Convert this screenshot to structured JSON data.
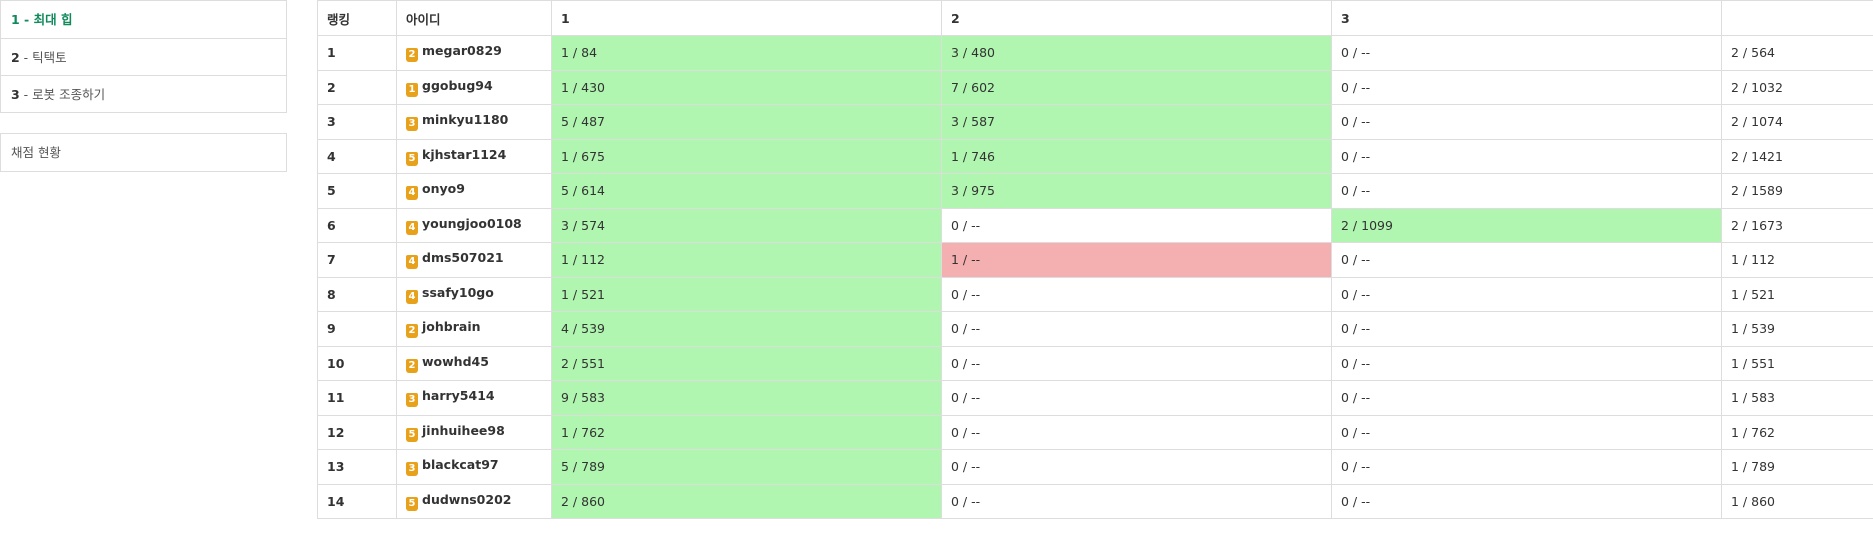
{
  "sidebar": {
    "problems": [
      {
        "num": "1",
        "title": " - 최대 힙",
        "active": true
      },
      {
        "num": "2",
        "title": " - 틱택토",
        "active": false
      },
      {
        "num": "3",
        "title": " - 로봇 조종하기",
        "active": false
      }
    ],
    "status_link": "채점 현황"
  },
  "table": {
    "headers": [
      "랭킹",
      "아이디",
      "1",
      "2",
      "3",
      ""
    ],
    "rows": [
      {
        "rank": "1",
        "tier": "2",
        "user": "megar0829",
        "p1": "1 / 84",
        "p1s": "ac",
        "p2": "3 / 480",
        "p2s": "ac",
        "p3": "0 / --",
        "p3s": "",
        "total": "2 / 564"
      },
      {
        "rank": "2",
        "tier": "1",
        "user": "ggobug94",
        "p1": "1 / 430",
        "p1s": "ac",
        "p2": "7 / 602",
        "p2s": "ac",
        "p3": "0 / --",
        "p3s": "",
        "total": "2 / 1032"
      },
      {
        "rank": "3",
        "tier": "3",
        "user": "minkyu1180",
        "p1": "5 / 487",
        "p1s": "ac",
        "p2": "3 / 587",
        "p2s": "ac",
        "p3": "0 / --",
        "p3s": "",
        "total": "2 / 1074"
      },
      {
        "rank": "4",
        "tier": "5",
        "user": "kjhstar1124",
        "p1": "1 / 675",
        "p1s": "ac",
        "p2": "1 / 746",
        "p2s": "ac",
        "p3": "0 / --",
        "p3s": "",
        "total": "2 / 1421"
      },
      {
        "rank": "5",
        "tier": "4",
        "user": "onyo9",
        "p1": "5 / 614",
        "p1s": "ac",
        "p2": "3 / 975",
        "p2s": "ac",
        "p3": "0 / --",
        "p3s": "",
        "total": "2 / 1589"
      },
      {
        "rank": "6",
        "tier": "4",
        "user": "youngjoo0108",
        "p1": "3 / 574",
        "p1s": "ac",
        "p2": "0 / --",
        "p2s": "",
        "p3": "2 / 1099",
        "p3s": "ac",
        "total": "2 / 1673"
      },
      {
        "rank": "7",
        "tier": "4",
        "user": "dms507021",
        "p1": "1 / 112",
        "p1s": "ac",
        "p2": "1 / --",
        "p2s": "wa",
        "p3": "0 / --",
        "p3s": "",
        "total": "1 / 112"
      },
      {
        "rank": "8",
        "tier": "4",
        "user": "ssafy10go",
        "p1": "1 / 521",
        "p1s": "ac",
        "p2": "0 / --",
        "p2s": "",
        "p3": "0 / --",
        "p3s": "",
        "total": "1 / 521"
      },
      {
        "rank": "9",
        "tier": "2",
        "user": "johbrain",
        "p1": "4 / 539",
        "p1s": "ac",
        "p2": "0 / --",
        "p2s": "",
        "p3": "0 / --",
        "p3s": "",
        "total": "1 / 539"
      },
      {
        "rank": "10",
        "tier": "2",
        "user": "wowhd45",
        "p1": "2 / 551",
        "p1s": "ac",
        "p2": "0 / --",
        "p2s": "",
        "p3": "0 / --",
        "p3s": "",
        "total": "1 / 551"
      },
      {
        "rank": "11",
        "tier": "3",
        "user": "harry5414",
        "p1": "9 / 583",
        "p1s": "ac",
        "p2": "0 / --",
        "p2s": "",
        "p3": "0 / --",
        "p3s": "",
        "total": "1 / 583"
      },
      {
        "rank": "12",
        "tier": "5",
        "user": "jinhuihee98",
        "p1": "1 / 762",
        "p1s": "ac",
        "p2": "0 / --",
        "p2s": "",
        "p3": "0 / --",
        "p3s": "",
        "total": "1 / 762"
      },
      {
        "rank": "13",
        "tier": "3",
        "user": "blackcat97",
        "p1": "5 / 789",
        "p1s": "ac",
        "p2": "0 / --",
        "p2s": "",
        "p3": "0 / --",
        "p3s": "",
        "total": "1 / 789"
      },
      {
        "rank": "14",
        "tier": "5",
        "user": "dudwns0202",
        "p1": "2 / 860",
        "p1s": "ac",
        "p2": "0 / --",
        "p2s": "",
        "p3": "0 / --",
        "p3s": "",
        "total": "1 / 860"
      }
    ]
  },
  "colors": {
    "accepted_bg": "#b0f5b0",
    "wrong_bg": "#f4b0b0",
    "active_link": "#0f8a5c",
    "tier_badge": "#e8a11a",
    "border": "#dddddd"
  },
  "icons": {
    "tier_badge": "tier-badge-icon"
  }
}
